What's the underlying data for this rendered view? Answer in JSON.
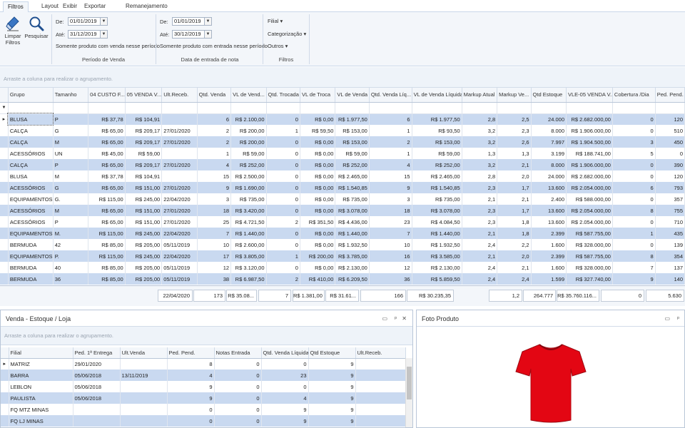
{
  "tabs": [
    "Filtros",
    "Layout",
    "Exibir",
    "Exportar",
    "Remanejamento"
  ],
  "ribbon": {
    "clear_label_1": "Limpar",
    "clear_label_2": "Filtros",
    "search_label": "Pesquisar",
    "sale_from_label": "De:",
    "sale_from_value": "01/01/2019",
    "sale_to_label": "Até:",
    "sale_to_value": "31/12/2019",
    "sale_note": "Somente produto com venda nesse período",
    "sale_group_title": "Período de Venda",
    "entry_from_label": "De:",
    "entry_from_value": "01/01/2019",
    "entry_to_label": "Até:",
    "entry_to_value": "30/12/2019",
    "entry_note": "Somente produto com entrada nesse período",
    "entry_group_title": "Data de entrada de nota",
    "filial_label": "Filial",
    "categ_label": "Categorização",
    "outros_label": "Outros",
    "filters_group_title": "Filtros"
  },
  "top_grid": {
    "group_hint": "Arraste a coluna para realizar o agrupamento.",
    "columns": [
      "Grupo",
      "Tamanho",
      "04 CUSTO F...",
      "05 VENDA V...",
      "Ult.Receb.",
      "Qtd. Venda",
      "VL de Vend...",
      "Qtd. Trocada",
      "VL de Troca",
      "VL de Venda",
      "Qtd. Venda Líq...",
      "VL de Venda Líquida",
      "Markup Atual",
      "Markup Ve...",
      "Qtd Estoque",
      "VLE-05 VENDA V...",
      "Cobertura /Dia",
      "Ped. Pend."
    ],
    "rows": [
      [
        "BLUSA",
        "P",
        "R$ 37,78",
        "R$ 104,91",
        "",
        "6",
        "R$ 2.100,00",
        "0",
        "R$ 0,00",
        "R$ 1.977,50",
        "6",
        "R$ 1.977,50",
        "2,8",
        "2,5",
        "24.000",
        "R$ 2.682.000,00",
        "0",
        "120"
      ],
      [
        "CALÇA",
        "G",
        "R$ 65,00",
        "R$ 209,17",
        "27/01/2020",
        "2",
        "R$ 200,00",
        "1",
        "R$ 59,50",
        "R$ 153,00",
        "1",
        "R$ 93,50",
        "3,2",
        "2,3",
        "8.000",
        "R$ 1.906.000,00",
        "0",
        "510"
      ],
      [
        "CALÇA",
        "M",
        "R$ 65,00",
        "R$ 209,17",
        "27/01/2020",
        "2",
        "R$ 200,00",
        "0",
        "R$ 0,00",
        "R$ 153,00",
        "2",
        "R$ 153,00",
        "3,2",
        "2,6",
        "7.997",
        "R$ 1.904.500,00",
        "3",
        "450"
      ],
      [
        "ACESSÓRIOS",
        "UN",
        "R$ 45,00",
        "R$ 59,00",
        "",
        "1",
        "R$ 59,00",
        "0",
        "R$ 0,00",
        "R$ 59,00",
        "1",
        "R$ 59,00",
        "1,3",
        "1,3",
        "3.199",
        "R$ 188.741,00",
        "5",
        "0"
      ],
      [
        "CALÇA",
        "P",
        "R$ 65,00",
        "R$ 209,17",
        "27/01/2020",
        "4",
        "R$ 252,00",
        "0",
        "R$ 0,00",
        "R$ 252,00",
        "4",
        "R$ 252,00",
        "3,2",
        "2,1",
        "8.000",
        "R$ 1.906.000,00",
        "0",
        "390"
      ],
      [
        "BLUSA",
        "M",
        "R$ 37,78",
        "R$ 104,91",
        "",
        "15",
        "R$ 2.500,00",
        "0",
        "R$ 0,00",
        "R$ 2.465,00",
        "15",
        "R$ 2.465,00",
        "2,8",
        "2,0",
        "24.000",
        "R$ 2.682.000,00",
        "0",
        "120"
      ],
      [
        "ACESSÓRIOS",
        "G",
        "R$ 65,00",
        "R$ 151,00",
        "27/01/2020",
        "9",
        "R$ 1.690,00",
        "0",
        "R$ 0,00",
        "R$ 1.540,85",
        "9",
        "R$ 1.540,85",
        "2,3",
        "1,7",
        "13.600",
        "R$ 2.054.000,00",
        "6",
        "793"
      ],
      [
        "EQUIPAMENTOS",
        "G.",
        "R$ 115,00",
        "R$ 245,00",
        "22/04/2020",
        "3",
        "R$ 735,00",
        "0",
        "R$ 0,00",
        "R$ 735,00",
        "3",
        "R$ 735,00",
        "2,1",
        "2,1",
        "2.400",
        "R$ 588.000,00",
        "0",
        "357"
      ],
      [
        "ACESSÓRIOS",
        "M",
        "R$ 65,00",
        "R$ 151,00",
        "27/01/2020",
        "18",
        "R$ 3.420,00",
        "0",
        "R$ 0,00",
        "R$ 3.078,00",
        "18",
        "R$ 3.078,00",
        "2,3",
        "1,7",
        "13.600",
        "R$ 2.054.000,00",
        "8",
        "755"
      ],
      [
        "ACESSÓRIOS",
        "P",
        "R$ 65,00",
        "R$ 151,00",
        "27/01/2020",
        "25",
        "R$ 4.721,50",
        "2",
        "R$ 351,50",
        "R$ 4.436,00",
        "23",
        "R$ 4.084,50",
        "2,3",
        "1,8",
        "13.600",
        "R$ 2.054.000,00",
        "0",
        "710"
      ],
      [
        "EQUIPAMENTOS",
        "M.",
        "R$ 115,00",
        "R$ 245,00",
        "22/04/2020",
        "7",
        "R$ 1.440,00",
        "0",
        "R$ 0,00",
        "R$ 1.440,00",
        "7",
        "R$ 1.440,00",
        "2,1",
        "1,8",
        "2.399",
        "R$ 587.755,00",
        "1",
        "435"
      ],
      [
        "BERMUDA",
        "42",
        "R$ 85,00",
        "R$ 205,00",
        "05/11/2019",
        "10",
        "R$ 2.600,00",
        "0",
        "R$ 0,00",
        "R$ 1.932,50",
        "10",
        "R$ 1.932,50",
        "2,4",
        "2,2",
        "1.600",
        "R$ 328.000,00",
        "0",
        "139"
      ],
      [
        "EQUIPAMENTOS",
        "P.",
        "R$ 115,00",
        "R$ 245,00",
        "22/04/2020",
        "17",
        "R$ 3.805,00",
        "1",
        "R$ 200,00",
        "R$ 3.785,00",
        "16",
        "R$ 3.585,00",
        "2,1",
        "2,0",
        "2.399",
        "R$ 587.755,00",
        "8",
        "354"
      ],
      [
        "BERMUDA",
        "40",
        "R$ 85,00",
        "R$ 205,00",
        "05/11/2019",
        "12",
        "R$ 3.120,00",
        "0",
        "R$ 0,00",
        "R$ 2.130,00",
        "12",
        "R$ 2.130,00",
        "2,4",
        "2,1",
        "1.600",
        "R$ 328.000,00",
        "7",
        "137"
      ],
      [
        "BERMUDA",
        "36",
        "R$ 85,00",
        "R$ 205,00",
        "05/11/2019",
        "38",
        "R$ 6.987,50",
        "2",
        "R$ 410,00",
        "R$ 6.209,50",
        "36",
        "R$ 5.859,50",
        "2,4",
        "2,4",
        "1.599",
        "R$ 327.740,00",
        "9",
        "140"
      ]
    ],
    "footer": {
      "ult_receb": "22/04/2020",
      "qtd_venda": "173",
      "vl_venda_bruto": "R$ 35.08...",
      "qtd_trocada": "7",
      "vl_troca": "R$ 1.381,00",
      "vl_venda": "R$ 31.61...",
      "qtd_liq": "166",
      "vl_liq": "R$ 30.235,35",
      "markup_ve": "1,2",
      "qtd_estoque": "264.777",
      "vle": "R$ 35.760.116...",
      "cobertura": "0",
      "ped_pend": "5.630"
    }
  },
  "store_panel": {
    "title": "Venda - Estoque / Loja",
    "group_hint": "Arraste a coluna para realizar o agrupamento.",
    "columns": [
      "Filial",
      "Ped. 1ª Entrega",
      "Ult.Venda",
      "Ped. Pend.",
      "Notas Entrada",
      "Qtd. Venda Líquida",
      "Qtd Estoque",
      "Ult.Receb."
    ],
    "rows": [
      [
        "MATRIZ",
        "29/01/2020",
        "",
        "8",
        "0",
        "0",
        "9",
        ""
      ],
      [
        "BARRA",
        "05/06/2018",
        "13/11/2019",
        "4",
        "0",
        "23",
        "9",
        ""
      ],
      [
        "LEBLON",
        "05/06/2018",
        "",
        "9",
        "0",
        "0",
        "9",
        ""
      ],
      [
        "PAULISTA",
        "05/06/2018",
        "",
        "9",
        "0",
        "4",
        "9",
        ""
      ],
      [
        "FQ MTZ MINAS",
        "",
        "",
        "0",
        "0",
        "9",
        "9",
        ""
      ],
      [
        "FQ LJ MINAS",
        "",
        "",
        "0",
        "0",
        "9",
        "9",
        ""
      ]
    ]
  },
  "photo_panel": {
    "title": "Foto Produto"
  },
  "colors": {
    "alt_row": "#c9d9f0",
    "ribbon_bg": "#f3f6fa",
    "shirt": "#e30613"
  }
}
